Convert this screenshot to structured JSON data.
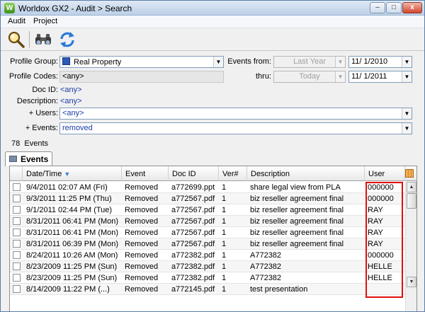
{
  "window": {
    "title": "Worldox GX2 - Audit > Search",
    "app_icon_letter": "W"
  },
  "window_controls": {
    "minimize": "–",
    "maximize": "□",
    "close": "x"
  },
  "menu": [
    "Audit",
    "Project"
  ],
  "toolbar": {
    "buttons": [
      {
        "name": "search-icon",
        "tooltip": ""
      },
      {
        "name": "binoculars-icon",
        "tooltip": ""
      },
      {
        "name": "refresh-icon",
        "tooltip": ""
      }
    ]
  },
  "form": {
    "profile_group_label": "Profile Group:",
    "profile_group_value": "Real Property",
    "profile_codes_label": "Profile Codes:",
    "profile_codes_value": "<any>",
    "doc_id_label": "Doc ID:",
    "doc_id_value": "<any>",
    "description_label": "Description:",
    "description_value": "<any>",
    "users_label": "+ Users:",
    "users_value": "<any>",
    "events_label": "+ Events:",
    "events_value": "removed",
    "events_from_label": "Events from:",
    "events_from_value": "Last Year",
    "events_from_date": "11/  1/2010",
    "thru_label": "thru:",
    "thru_value": "Today",
    "thru_date": "11/  1/2011"
  },
  "events_count": {
    "count": "78",
    "label": "Events"
  },
  "tab": {
    "label": "Events"
  },
  "grid": {
    "columns": [
      "Date/Time",
      "Event",
      "Doc ID",
      "Ver#",
      "Description",
      "User"
    ],
    "rows": [
      [
        "9/4/2011 02:07 AM (Fri)",
        "Removed",
        "a772699.ppt",
        "1",
        "share legal view from PLA",
        "000000"
      ],
      [
        "9/3/2011 11:25 PM (Thu)",
        "Removed",
        "a772567.pdf",
        "1",
        "biz reseller agreement final",
        "000000"
      ],
      [
        "9/1/2011 02:44 PM (Tue)",
        "Removed",
        "a772567.pdf",
        "1",
        "biz reseller agreement final",
        "RAY"
      ],
      [
        "8/31/2011 06:41 PM (Mon)",
        "Removed",
        "a772567.pdf",
        "1",
        "biz reseller agreement final",
        "RAY"
      ],
      [
        "8/31/2011 06:41 PM (Mon)",
        "Removed",
        "a772567.pdf",
        "1",
        "biz reseller agreement final",
        "RAY"
      ],
      [
        "8/31/2011 06:39 PM (Mon)",
        "Removed",
        "a772567.pdf",
        "1",
        "biz reseller agreement final",
        "RAY"
      ],
      [
        "8/24/2011 10:26 AM (Mon)",
        "Removed",
        "a772382.pdf",
        "1",
        "A772382",
        "000000"
      ],
      [
        "8/23/2009 11:25 PM (Sun)",
        "Removed",
        "a772382.pdf",
        "1",
        "A772382",
        "HELLE"
      ],
      [
        "8/23/2009 11:25 PM (Sun)",
        "Removed",
        "a772382.pdf",
        "1",
        "A772382",
        "HELLE"
      ],
      [
        "8/14/2009 11:22 PM (...)",
        "Removed",
        "a772145.pdf",
        "1",
        "test presentation",
        ""
      ]
    ]
  },
  "colors": {
    "highlight": "#e01010",
    "link": "#1a3ca8",
    "accent": "#3c7fd6"
  }
}
